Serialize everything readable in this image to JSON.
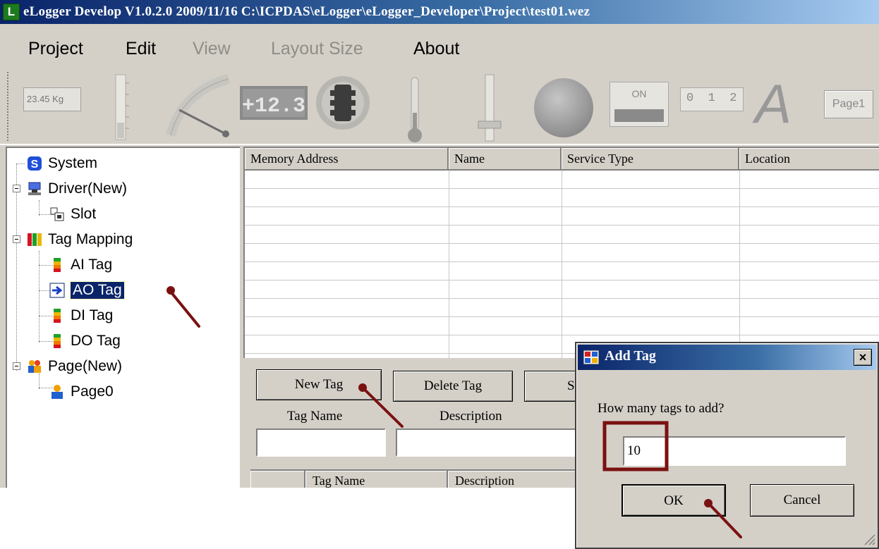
{
  "window": {
    "title": "eLogger Develop V1.0.2.0  2009/11/16  C:\\ICPDAS\\eLogger\\eLogger_Developer\\Project\\test01.wez",
    "app_icon_letter": "L"
  },
  "menu": {
    "items": [
      {
        "label": "Project",
        "enabled": true
      },
      {
        "label": "Edit",
        "enabled": true
      },
      {
        "label": "View",
        "enabled": false
      },
      {
        "label": "Layout Size",
        "enabled": false
      },
      {
        "label": "About",
        "enabled": true
      }
    ]
  },
  "toolbar": {
    "text_value": "23.45 Kg",
    "digital_display": "+12.3",
    "switch_label": "ON",
    "index_display": "0  1  2",
    "font_tool": "A",
    "page_button": "Page1",
    "tool_icons": [
      "text-display-icon",
      "vertical-gauge-icon",
      "meter-gauge-icon",
      "seven-segment-icon",
      "traffic-light-icon",
      "thermometer-icon",
      "slider-icon",
      "lamp-icon",
      "switch-icon",
      "index-display-icon",
      "font-label-icon",
      "page-button-icon"
    ]
  },
  "tree": {
    "items": [
      {
        "label": "System",
        "icon": "system-icon"
      },
      {
        "label": "Driver(New)",
        "icon": "driver-icon"
      },
      {
        "label": "Slot",
        "icon": "slot-icon"
      },
      {
        "label": "Tag Mapping",
        "icon": "tag-mapping-icon"
      },
      {
        "label": "AI Tag",
        "icon": "tag-icon"
      },
      {
        "label": "AO Tag",
        "icon": "arrow-right-icon",
        "selected": true
      },
      {
        "label": "DI Tag",
        "icon": "tag-icon"
      },
      {
        "label": "DO Tag",
        "icon": "tag-icon"
      },
      {
        "label": "Page(New)",
        "icon": "page-group-icon"
      },
      {
        "label": "Page0",
        "icon": "page-icon"
      }
    ]
  },
  "grid": {
    "columns": [
      "Memory Address",
      "Name",
      "Service Type",
      "Location"
    ],
    "rows": []
  },
  "tag_editor": {
    "new_tag_label": "New Tag",
    "delete_tag_label": "Delete Tag",
    "partial_button_label": "S",
    "tag_name_label": "Tag Name",
    "description_label": "Description",
    "list_columns": [
      "Tag Name",
      "Description"
    ]
  },
  "dialog": {
    "title": "Add Tag",
    "close_label": "×",
    "prompt": "How many tags to add?",
    "value": "10",
    "ok_label": "OK",
    "cancel_label": "Cancel"
  },
  "colors": {
    "title_gradient_start": "#0a246a",
    "title_gradient_end": "#a6caf0",
    "annotation": "#7a1111",
    "window_bg": "#d4d0c8"
  }
}
